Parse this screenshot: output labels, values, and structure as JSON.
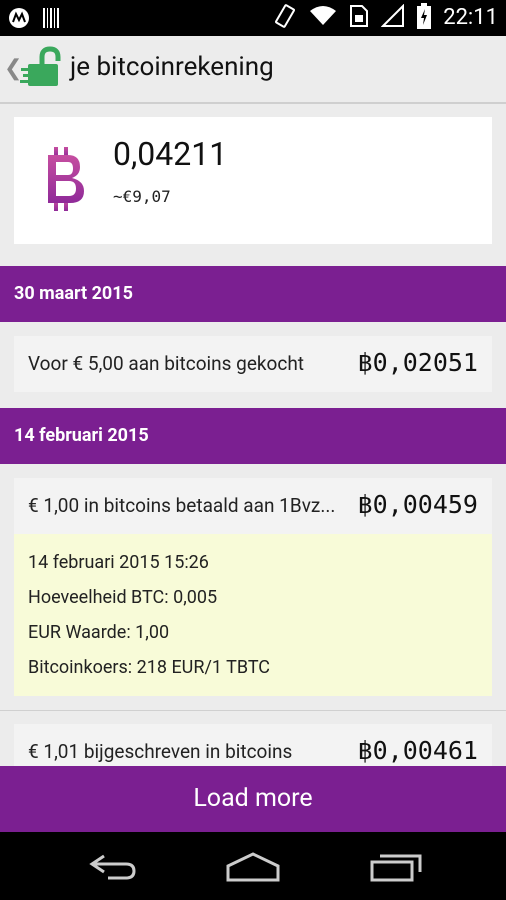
{
  "status_bar": {
    "time": "22:11",
    "icons": [
      "motorola-icon",
      "barcode-icon",
      "vibrate-icon",
      "wifi-icon",
      "sim-icon",
      "signal-icon",
      "battery-icon"
    ]
  },
  "action_bar": {
    "title": "je bitcoinrekening",
    "back_icon": "chevron-left-icon",
    "logo_icon": "green-padlock-logo"
  },
  "balance": {
    "amount": "0,04211",
    "fiat": "~€9,07",
    "icon": "bitcoin-b-icon",
    "accent_color": "#b0349a"
  },
  "groups": [
    {
      "date": "30 maart 2015",
      "transactions": [
        {
          "description": "Voor € 5,00 aan bitcoins gekocht",
          "amount": "฿0,02051"
        }
      ]
    },
    {
      "date": "14 februari 2015",
      "transactions": [
        {
          "description": "€ 1,00 in bitcoins betaald aan 1Bvz...",
          "amount": "฿0,00459",
          "details": {
            "datetime": "14 februari 2015 15:26",
            "quantity": "Hoeveelheid BTC: 0,005",
            "eur_value": "EUR Waarde: 1,00",
            "rate": "Bitcoinkoers: 218 EUR/1 TBTC"
          }
        },
        {
          "description": "€ 1,01 bijgeschreven in bitcoins",
          "amount": "฿0,00461"
        }
      ]
    }
  ],
  "load_more_label": "Load more",
  "nav_bar": {
    "icons": [
      "back-icon",
      "home-icon",
      "recents-icon"
    ]
  },
  "colors": {
    "primary_purple": "#7b1f91",
    "detail_background": "#f8fbd8",
    "status_bar": "#000000"
  }
}
